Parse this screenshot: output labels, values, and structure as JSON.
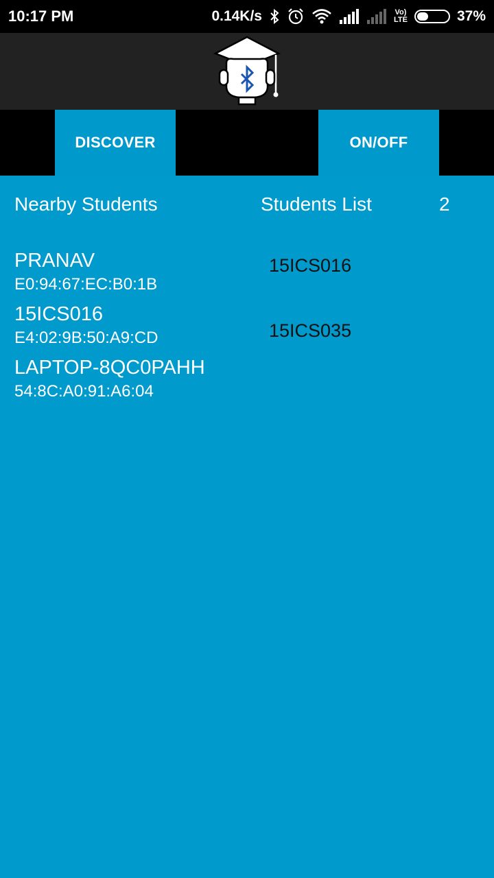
{
  "status_bar": {
    "time": "10:17 PM",
    "net_speed": "0.14K/s",
    "volte_label_top": "Vo)",
    "volte_label_bottom": "LTE",
    "battery_percent": "37%",
    "battery_level": 0.37
  },
  "buttons": {
    "discover": "DISCOVER",
    "onoff": "ON/OFF"
  },
  "nearby": {
    "title": "Nearby Students",
    "devices": [
      {
        "name": "PRANAV",
        "address": "E0:94:67:EC:B0:1B"
      },
      {
        "name": "15ICS016",
        "address": "E4:02:9B:50:A9:CD"
      },
      {
        "name": "LAPTOP-8QC0PAHH",
        "address": "54:8C:A0:91:A6:04"
      }
    ]
  },
  "students": {
    "title": "Students List",
    "count": "2",
    "items": [
      "15ICS016",
      "15ICS035"
    ]
  },
  "colors": {
    "accent": "#0099cc",
    "header": "#222222",
    "background": "#009acd"
  }
}
